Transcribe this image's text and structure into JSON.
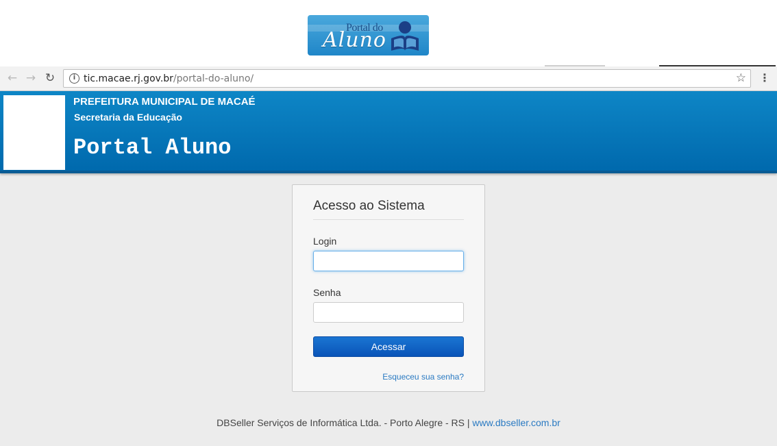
{
  "logo": {
    "line1": "Portal do",
    "line2": "Aluno"
  },
  "browser": {
    "url_host": "tic.macae.rj.gov.br",
    "url_path": "/portal-do-aluno/"
  },
  "header": {
    "org": "PREFEITURA MUNICIPAL DE MACAÉ",
    "dept": "Secretaria da Educação",
    "portal_title": "Portal Aluno"
  },
  "login": {
    "title": "Acesso ao Sistema",
    "login_label": "Login",
    "login_value": "",
    "password_label": "Senha",
    "password_value": "",
    "submit_label": "Acessar",
    "forgot_label": "Esqueceu sua senha?"
  },
  "footer": {
    "text": "DBSeller Serviços de Informática Ltda. - Porto Alegre - RS |",
    "link": "www.dbseller.com.br"
  },
  "colors": {
    "header_blue": "#0069ad",
    "button_blue": "#0a54b8",
    "link_blue": "#2a7ac2"
  }
}
